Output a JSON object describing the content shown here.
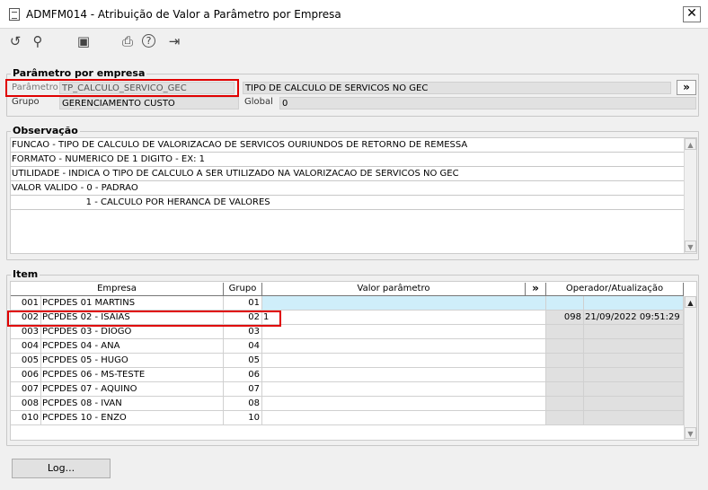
{
  "window": {
    "title": "ADMFM014 - Atribuição de Valor a Parâmetro por Empresa",
    "close": "✕"
  },
  "toolbar": [
    {
      "name": "undo-icon",
      "glyph": "↺"
    },
    {
      "name": "search-icon",
      "glyph": "⚲"
    },
    {
      "name": "save-icon",
      "glyph": "▣"
    },
    {
      "name": "print-icon",
      "glyph": "⎙"
    },
    {
      "name": "help-icon",
      "glyph": "?"
    },
    {
      "name": "exit-icon",
      "glyph": "⇥"
    }
  ],
  "param_section": {
    "title": "Parâmetro por empresa",
    "parametro_label": "Parâmetro",
    "parametro_value": "TP_CALCULO_SERVICO_GEC",
    "description": "TIPO DE CALCULO DE SERVICOS NO GEC",
    "expand": "»",
    "grupo_label": "Grupo",
    "grupo_value": "GERENCIAMENTO CUSTO",
    "global_label": "Global",
    "global_value": "0"
  },
  "obs_section": {
    "title": "Observação",
    "lines": [
      "FUNCAO - TIPO DE CALCULO DE VALORIZACAO DE SERVICOS OURIUNDOS DE RETORNO DE REMESSA",
      "FORMATO - NUMERICO DE  1 DIGITO - EX: 1",
      "UTILIDADE - INDICA O TIPO DE CALCULO A SER UTILIZADO NA VALORIZACAO DE SERVICOS NO GEC",
      "VALOR VALIDO - 0 - PADRAO",
      "                          1 - CALCULO POR HERANCA DE VALORES"
    ]
  },
  "item_section": {
    "title": "Item",
    "headers": {
      "empresa": "Empresa",
      "grupo": "Grupo",
      "valor": "Valor parâmetro",
      "expand": "»",
      "operador": "Operador/Atualização"
    },
    "rows": [
      {
        "code": "001",
        "name": "PCPDES 01 MARTINS",
        "grupo": "01",
        "valor": "",
        "op": "",
        "dt": ""
      },
      {
        "code": "002",
        "name": "PCPDES 02 - ISAIAS",
        "grupo": "02",
        "valor": "1",
        "op": "098",
        "dt": "21/09/2022 09:51:29"
      },
      {
        "code": "003",
        "name": "PCPDES 03 - DIOGO",
        "grupo": "03",
        "valor": "",
        "op": "",
        "dt": ""
      },
      {
        "code": "004",
        "name": "PCPDES 04 - ANA",
        "grupo": "04",
        "valor": "",
        "op": "",
        "dt": ""
      },
      {
        "code": "005",
        "name": "PCPDES 05 - HUGO",
        "grupo": "05",
        "valor": "",
        "op": "",
        "dt": ""
      },
      {
        "code": "006",
        "name": "PCPDES 06 - MS-TESTE",
        "grupo": "06",
        "valor": "",
        "op": "",
        "dt": ""
      },
      {
        "code": "007",
        "name": "PCPDES 07 - AQUINO",
        "grupo": "07",
        "valor": "",
        "op": "",
        "dt": ""
      },
      {
        "code": "008",
        "name": "PCPDES 08 - IVAN",
        "grupo": "08",
        "valor": "",
        "op": "",
        "dt": ""
      },
      {
        "code": "010",
        "name": "PCPDES 10 - ENZO",
        "grupo": "10",
        "valor": "",
        "op": "",
        "dt": ""
      }
    ]
  },
  "log_button": "Log...",
  "colors": {
    "highlight": "#e00000",
    "selected_value": "#cfeefa",
    "readonly": "#e1e1e1"
  }
}
